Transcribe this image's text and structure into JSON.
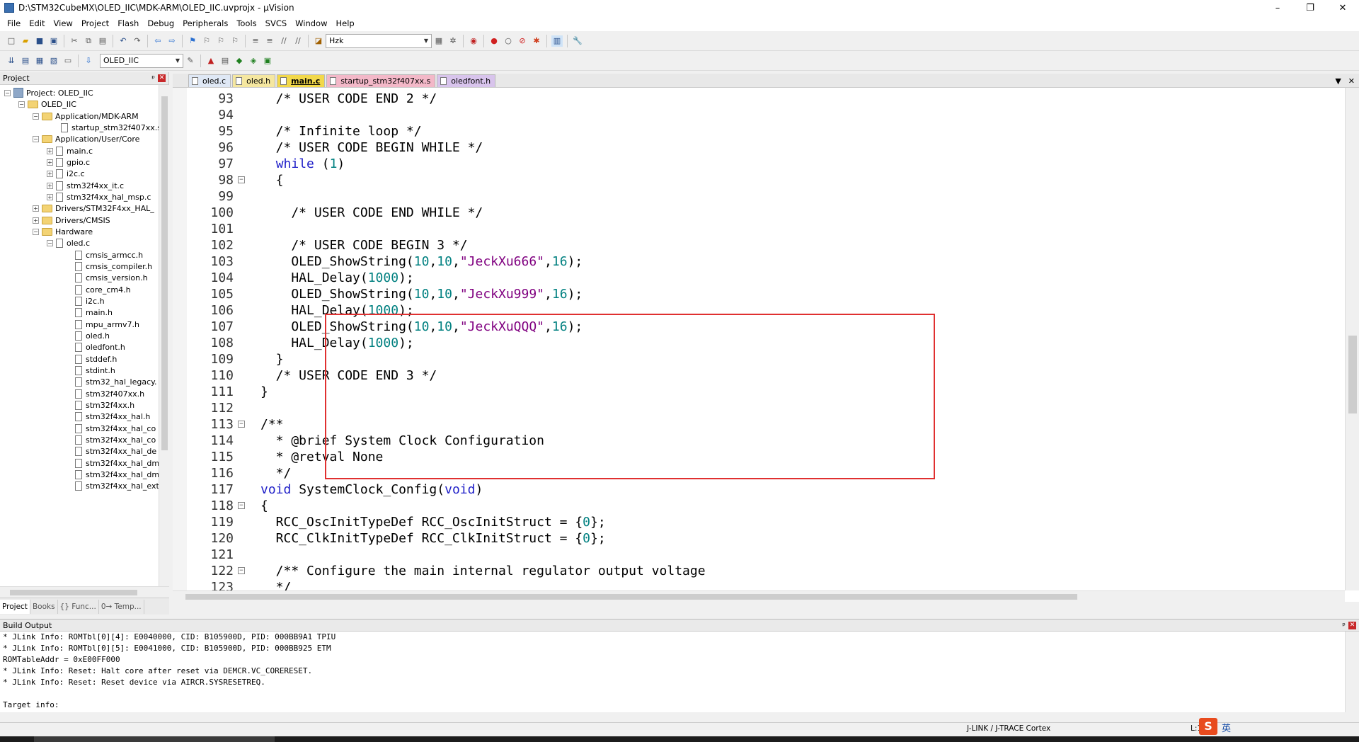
{
  "window": {
    "title": "D:\\STM32CubeMX\\OLED_IIC\\MDK-ARM\\OLED_IIC.uvprojx - µVision",
    "minimize": "–",
    "maximize": "❐",
    "close": "✕"
  },
  "menu": [
    "File",
    "Edit",
    "View",
    "Project",
    "Flash",
    "Debug",
    "Peripherals",
    "Tools",
    "SVCS",
    "Window",
    "Help"
  ],
  "toolbar": {
    "find_combo": "Hzk",
    "target_combo": "OLED_IIC"
  },
  "project_pane": {
    "title": "Project",
    "pin": "ᵖ",
    "close": "✕",
    "tree": [
      {
        "label": "Project: OLED_IIC",
        "exp": "−"
      },
      {
        "label": "OLED_IIC",
        "exp": "−"
      },
      {
        "label": "Application/MDK-ARM",
        "exp": "−"
      },
      {
        "label": "startup_stm32f407xx.s",
        "exp": ""
      },
      {
        "label": "Application/User/Core",
        "exp": "−"
      },
      {
        "label": "main.c",
        "exp": "+"
      },
      {
        "label": "gpio.c",
        "exp": "+"
      },
      {
        "label": "i2c.c",
        "exp": "+"
      },
      {
        "label": "stm32f4xx_it.c",
        "exp": "+"
      },
      {
        "label": "stm32f4xx_hal_msp.c",
        "exp": "+"
      },
      {
        "label": "Drivers/STM32F4xx_HAL_",
        "exp": "+"
      },
      {
        "label": "Drivers/CMSIS",
        "exp": "+"
      },
      {
        "label": "Hardware",
        "exp": "−"
      },
      {
        "label": "oled.c",
        "exp": "−"
      },
      {
        "label": "cmsis_armcc.h",
        "exp": ""
      },
      {
        "label": "cmsis_compiler.h",
        "exp": ""
      },
      {
        "label": "cmsis_version.h",
        "exp": ""
      },
      {
        "label": "core_cm4.h",
        "exp": ""
      },
      {
        "label": "i2c.h",
        "exp": ""
      },
      {
        "label": "main.h",
        "exp": ""
      },
      {
        "label": "mpu_armv7.h",
        "exp": ""
      },
      {
        "label": "oled.h",
        "exp": ""
      },
      {
        "label": "oledfont.h",
        "exp": ""
      },
      {
        "label": "stddef.h",
        "exp": ""
      },
      {
        "label": "stdint.h",
        "exp": ""
      },
      {
        "label": "stm32_hal_legacy.",
        "exp": ""
      },
      {
        "label": "stm32f407xx.h",
        "exp": ""
      },
      {
        "label": "stm32f4xx.h",
        "exp": ""
      },
      {
        "label": "stm32f4xx_hal.h",
        "exp": ""
      },
      {
        "label": "stm32f4xx_hal_co",
        "exp": ""
      },
      {
        "label": "stm32f4xx_hal_co",
        "exp": ""
      },
      {
        "label": "stm32f4xx_hal_de",
        "exp": ""
      },
      {
        "label": "stm32f4xx_hal_dm",
        "exp": ""
      },
      {
        "label": "stm32f4xx_hal_dm",
        "exp": ""
      },
      {
        "label": "stm32f4xx_hal_ext",
        "exp": ""
      }
    ],
    "bottom_tabs": [
      "Project",
      "Books",
      "{} Func...",
      "0→ Temp..."
    ]
  },
  "editor": {
    "tabs": [
      "oled.c",
      "oled.h",
      "main.c",
      "startup_stm32f407xx.s",
      "oledfont.h"
    ],
    "tab_menu": "▼",
    "tab_close": "✕",
    "lines": [
      {
        "n": "93",
        "code": "  /* USER CODE END 2 */",
        "fold": "",
        "warn": false
      },
      {
        "n": "94",
        "code": "",
        "fold": "",
        "warn": false
      },
      {
        "n": "95",
        "code": "  /* Infinite loop */",
        "fold": "",
        "warn": false
      },
      {
        "n": "96",
        "code": "  /* USER CODE BEGIN WHILE */",
        "fold": "",
        "warn": false
      },
      {
        "n": "97",
        "code": "  while (1)",
        "fold": "",
        "warn": false
      },
      {
        "n": "98",
        "code": "  {",
        "fold": "−",
        "warn": false
      },
      {
        "n": "99",
        "code": "",
        "fold": "",
        "warn": false
      },
      {
        "n": "100",
        "code": "    /* USER CODE END WHILE */",
        "fold": "",
        "warn": false
      },
      {
        "n": "101",
        "code": "",
        "fold": "",
        "warn": false
      },
      {
        "n": "102",
        "code": "    /* USER CODE BEGIN 3 */",
        "fold": "",
        "warn": false
      },
      {
        "n": "103",
        "code": "    OLED_ShowString(10,10,\"JeckXu666\",16);",
        "fold": "",
        "warn": true
      },
      {
        "n": "104",
        "code": "    HAL_Delay(1000);",
        "fold": "",
        "warn": false
      },
      {
        "n": "105",
        "code": "    OLED_ShowString(10,10,\"JeckXu999\",16);",
        "fold": "",
        "warn": true
      },
      {
        "n": "106",
        "code": "    HAL_Delay(1000);",
        "fold": "",
        "warn": false
      },
      {
        "n": "107",
        "code": "    OLED_ShowString(10,10,\"JeckXuQQQ\",16);",
        "fold": "",
        "warn": true
      },
      {
        "n": "108",
        "code": "    HAL_Delay(1000);",
        "fold": "",
        "warn": false
      },
      {
        "n": "109",
        "code": "  }",
        "fold": "",
        "warn": false
      },
      {
        "n": "110",
        "code": "  /* USER CODE END 3 */",
        "fold": "",
        "warn": false
      },
      {
        "n": "111",
        "code": "}",
        "fold": "",
        "warn": false
      },
      {
        "n": "112",
        "code": "",
        "fold": "",
        "warn": false
      },
      {
        "n": "113",
        "code": "/**",
        "fold": "−",
        "warn": false
      },
      {
        "n": "114",
        "code": "  * @brief System Clock Configuration",
        "fold": "",
        "warn": false
      },
      {
        "n": "115",
        "code": "  * @retval None",
        "fold": "",
        "warn": false
      },
      {
        "n": "116",
        "code": "  */",
        "fold": "",
        "warn": false
      },
      {
        "n": "117",
        "code": "void SystemClock_Config(void)",
        "fold": "",
        "warn": false
      },
      {
        "n": "118",
        "code": "{",
        "fold": "−",
        "warn": false
      },
      {
        "n": "119",
        "code": "  RCC_OscInitTypeDef RCC_OscInitStruct = {0};",
        "fold": "",
        "warn": false
      },
      {
        "n": "120",
        "code": "  RCC_ClkInitTypeDef RCC_ClkInitStruct = {0};",
        "fold": "",
        "warn": false
      },
      {
        "n": "121",
        "code": "",
        "fold": "",
        "warn": false
      },
      {
        "n": "122",
        "code": "  /** Configure the main internal regulator output voltage",
        "fold": "−",
        "warn": false
      },
      {
        "n": "123",
        "code": "  */",
        "fold": "",
        "warn": false
      }
    ]
  },
  "build_output": {
    "title": "Build Output",
    "lines": [
      "* JLink Info: ROMTbl[0][4]: E0040000, CID: B105900D, PID: 000BB9A1 TPIU",
      "* JLink Info: ROMTbl[0][5]: E0041000, CID: B105900D, PID: 000BB925 ETM",
      "ROMTableAddr = 0xE00FF000",
      "* JLink Info: Reset: Halt core after reset via DEMCR.VC_CORERESET.",
      "* JLink Info: Reset: Reset device via AIRCR.SYSRESETREQ.",
      "",
      "Target info:"
    ]
  },
  "status": {
    "target": "J-LINK / J-TRACE Cortex",
    "pos": "L:1",
    "ime": "S",
    "ime_lang": "英"
  }
}
